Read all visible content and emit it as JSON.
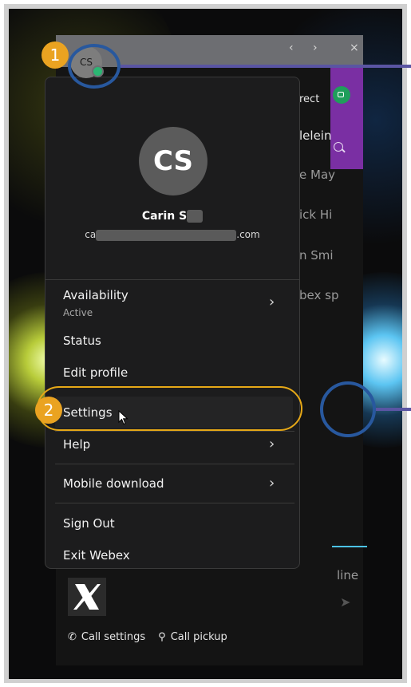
{
  "profile": {
    "initials": "CS",
    "name": "Carin S",
    "email_prefix": "ca",
    "email_suffix": ".com"
  },
  "menu": {
    "availability_label": "Availability",
    "availability_value": "Active",
    "status_label": "Status",
    "edit_profile_label": "Edit profile",
    "settings_label": "Settings",
    "help_label": "Help",
    "mobile_download_label": "Mobile download",
    "sign_out_label": "Sign Out",
    "exit_label": "Exit Webex"
  },
  "background_list": [
    "rect",
    "lelein",
    "e May",
    "ick Hi",
    "n Smi",
    "bex sp"
  ],
  "composer_hint": "line",
  "bottom_bar": {
    "call_settings": "Call settings",
    "call_pickup": "Call pickup"
  },
  "callouts": {
    "step1": "1",
    "step2": "2"
  },
  "colors": {
    "badge": "#eaa321",
    "highlight_circle": "#28589e",
    "pill": "#e6a817",
    "presence": "#2bb673",
    "sidebar_accent": "#7a2fa3"
  }
}
